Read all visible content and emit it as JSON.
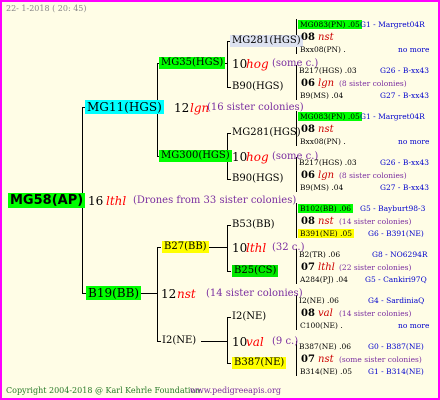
{
  "date": "22- 1-2018 ( 20: 45)",
  "root": {
    "name": "MG58(AP)",
    "num": "16",
    "mark": "lthl",
    "desc": "(Drones from 33 sister colonies)"
  },
  "g1": {
    "top": {
      "name": "MG11(HGS)",
      "num": "12",
      "mark": "lgn",
      "desc": "(16 sister colonies)"
    },
    "bot": {
      "name": "B19(BB)",
      "num": "12",
      "mark": "nst",
      "desc": "(14 sister colonies)"
    }
  },
  "g2": {
    "a": {
      "name": "MG35(HGS)",
      "num": "10",
      "mark": "hog",
      "desc": "(some c.)"
    },
    "b": {
      "name": "MG300(HGS)",
      "num": "10",
      "mark": "hog",
      "desc": "(some c.)"
    },
    "c": {
      "name": "B27(BB)",
      "num": "10",
      "mark": "lthl",
      "desc": "(32 c.)"
    },
    "d": {
      "name": "I2(NE)",
      "num": "10",
      "mark": "val",
      "desc": "(9 c.)"
    }
  },
  "g3": [
    {
      "name": "MG281(HGS)"
    },
    {
      "name": "B90(HGS)"
    },
    {
      "name": "MG281(HGS)"
    },
    {
      "name": "B90(HGS)"
    },
    {
      "name": "B53(BB)"
    },
    {
      "name": "B25(CS)"
    },
    {
      "name": "I2(NE)"
    },
    {
      "name": "B387(NE)"
    }
  ],
  "g4": [
    {
      "l1": "MG083(PN) .05",
      "l1b": "G1 - Margret04R",
      "num": "08",
      "mark": "nst",
      "l3": "Bxx08(PN) .",
      "l3b": "no more"
    },
    {
      "l1": "B217(HGS) .03",
      "l1b": "G26 - B-xx43",
      "num": "06",
      "mark": "lgn",
      "desc": "(8 sister colonies)",
      "l3": "B9(MS) .04",
      "l3b": "G27 - B-xx43"
    },
    {
      "l1": "MG083(PN) .05",
      "l1b": "G1 - Margret04R",
      "num": "08",
      "mark": "nst",
      "l3": "Bxx08(PN) .",
      "l3b": "no more"
    },
    {
      "l1": "B217(HGS) .03",
      "l1b": "G26 - B-xx43",
      "num": "06",
      "mark": "lgn",
      "desc": "(8 sister colonies)",
      "l3": "B9(MS) .04",
      "l3b": "G27 - B-xx43"
    },
    {
      "l1": "B102(BB) .06",
      "l1b": "G5 - Bayburt98-3",
      "num": "08",
      "mark": "nst",
      "desc": "(14 sister colonies)",
      "l3": "B391(NE) .05",
      "l3b": "G6 - B391(NE)"
    },
    {
      "l1": "B2(TR) .06",
      "l1b": "G8 - NO6294R",
      "num": "07",
      "mark": "lthl",
      "desc": "(22 sister colonies)",
      "l3": "A284(PJ) .04",
      "l3b": "G5 - Cankiri97Q"
    },
    {
      "l1": "I2(NE) .06",
      "l1b": "G4 - SardiniaQ",
      "num": "08",
      "mark": "val",
      "desc": "(14 sister colonies)",
      "l3": "C100(NE) .",
      "l3b": "no more"
    },
    {
      "l1": "B387(NE) .06",
      "l1b": "G0 - B387(NE)",
      "num": "07",
      "mark": "nst",
      "desc": "(some sister colonies)",
      "l3": "B314(NE) .05",
      "l3b": "G1 - B314(NE)"
    }
  ],
  "footer": {
    "left": "Copyright 2004-2018 @ Karl Kehrle Foundation.",
    "right": "www.pedigreeapis.org"
  }
}
